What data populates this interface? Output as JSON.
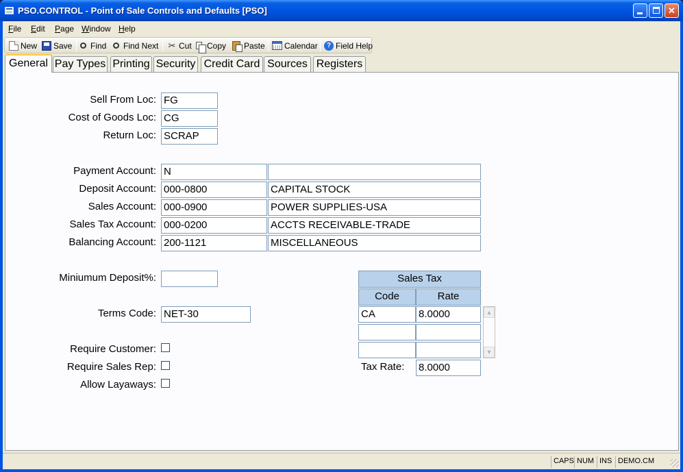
{
  "window": {
    "title": "PSO.CONTROL - Point of Sale Controls and Defaults [PSO]",
    "minimize": "_",
    "maximize": "□",
    "close": "✕"
  },
  "menu": {
    "items": [
      {
        "label": "File",
        "accel": "F"
      },
      {
        "label": "Edit",
        "accel": "E"
      },
      {
        "label": "Page",
        "accel": "P"
      },
      {
        "label": "Window",
        "accel": "W"
      },
      {
        "label": "Help",
        "accel": "H"
      }
    ]
  },
  "toolbar": {
    "new": "New",
    "save": "Save",
    "find": "Find",
    "find_next": "Find Next",
    "cut": "Cut",
    "copy": "Copy",
    "paste": "Paste",
    "calendar": "Calendar",
    "field_help": "Field Help"
  },
  "tabs": [
    "General",
    "Pay Types",
    "Printing",
    "Security",
    "Credit Card",
    "Sources",
    "Registers"
  ],
  "active_tab": "General",
  "form": {
    "sell_from_loc": {
      "label": "Sell From Loc:",
      "value": "FG"
    },
    "cost_of_goods_loc": {
      "label": "Cost of Goods Loc:",
      "value": "CG"
    },
    "return_loc": {
      "label": "Return Loc:",
      "value": "SCRAP"
    },
    "payment_account": {
      "label": "Payment Account:",
      "value": "N",
      "desc": ""
    },
    "deposit_account": {
      "label": "Deposit Account:",
      "value": "000-0800",
      "desc": "CAPITAL STOCK"
    },
    "sales_account": {
      "label": "Sales Account:",
      "value": "000-0900",
      "desc": "POWER SUPPLIES-USA"
    },
    "sales_tax_account": {
      "label": "Sales Tax Account:",
      "value": "000-0200",
      "desc": "ACCTS RECEIVABLE-TRADE"
    },
    "balancing_account": {
      "label": "Balancing Account:",
      "value": "200-1121",
      "desc": "MISCELLANEOUS"
    },
    "minimum_deposit": {
      "label": "Miniumum Deposit%:",
      "value": ""
    },
    "terms_code": {
      "label": "Terms Code:",
      "value": "NET-30"
    },
    "require_customer": {
      "label": "Require Customer:",
      "checked": false
    },
    "require_sales_rep": {
      "label": "Require Sales Rep:",
      "checked": false
    },
    "allow_layaways": {
      "label": "Allow Layaways:",
      "checked": false
    }
  },
  "sales_tax": {
    "title": "Sales Tax",
    "col_code": "Code",
    "col_rate": "Rate",
    "rows": [
      {
        "code": "CA",
        "rate": "8.0000"
      },
      {
        "code": "",
        "rate": ""
      },
      {
        "code": "",
        "rate": ""
      }
    ],
    "tax_rate_label": "Tax Rate:",
    "tax_rate_value": "8.0000"
  },
  "status": {
    "caps": "CAPS",
    "num": "NUM",
    "ins": "INS",
    "account": "DEMO.CM"
  }
}
